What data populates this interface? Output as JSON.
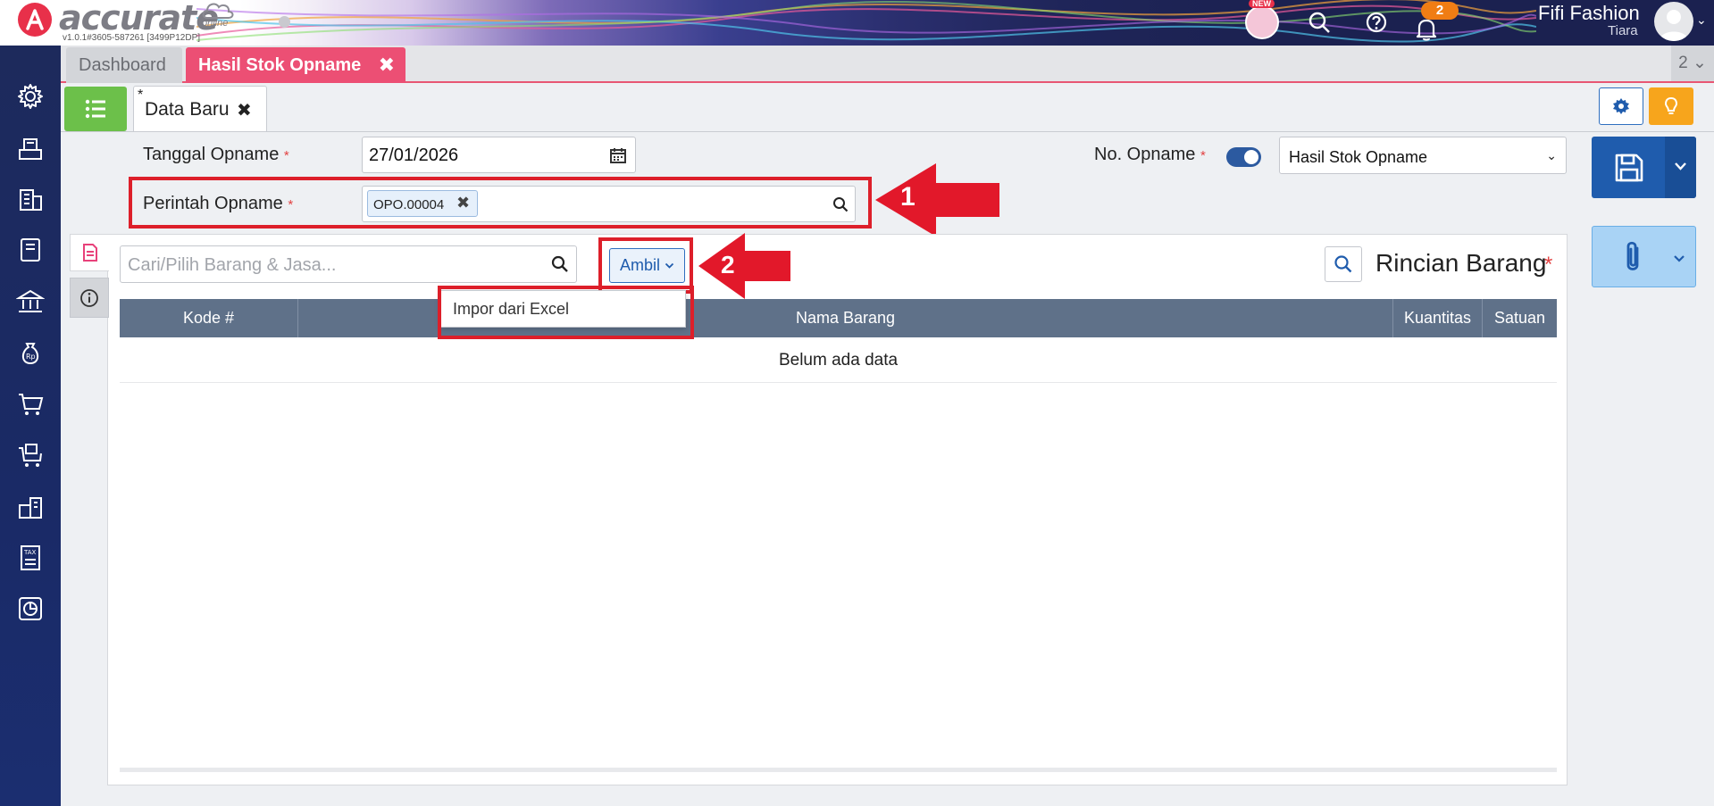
{
  "app": {
    "logo_text": "accurate",
    "logo_sub": "online",
    "version": "v1.0.1#3605-587261 [3499P12DP]",
    "new_badge": "NEW",
    "notification_count": "2",
    "user_name": "Fifi Fashion",
    "user_sub": "Tiara"
  },
  "tabs": {
    "dashboard": "Dashboard",
    "active": "Hasil Stok Opname",
    "close": "✖",
    "count": "2 ⌄"
  },
  "subtab": {
    "star": "*",
    "label": "Data Baru",
    "close": "✖"
  },
  "form": {
    "tanggal_label": "Tanggal Opname",
    "tanggal_value": "27/01/2026",
    "perintah_label": "Perintah Opname",
    "perintah_chip": "OPO.00004",
    "chip_close": "✖",
    "no_label": "No. Opname",
    "no_select_value": "Hasil Stok Opname",
    "required_mark": "*"
  },
  "panel": {
    "search_placeholder": "Cari/Pilih Barang & Jasa...",
    "ambil_label": "Ambil",
    "dropdown_item": "Impor dari Excel",
    "title": "Rincian Barang",
    "columns": [
      "Kode #",
      "Nama Barang",
      "Kuantitas",
      "Satuan"
    ],
    "empty_text": "Belum ada data"
  },
  "annotations": {
    "step1": "1",
    "step2": "2"
  },
  "colors": {
    "accent_pink": "#ec4f74",
    "sidebar": "#1d2a5c",
    "highlight": "#dd1f2a",
    "primary": "#1f5cad"
  }
}
